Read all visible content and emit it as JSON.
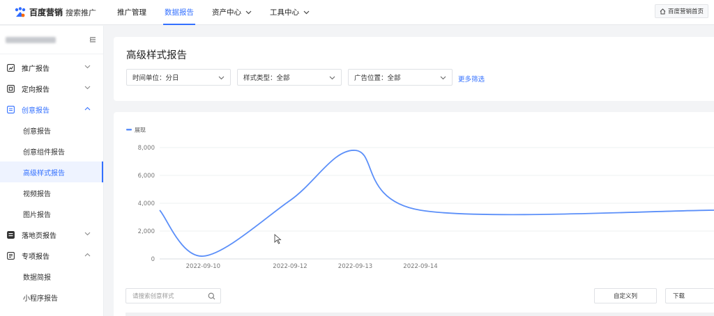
{
  "topnav": {
    "brand": "百度营销",
    "product": "搜索推广",
    "items": [
      {
        "label": "推广管理",
        "active": false,
        "dropdown": false
      },
      {
        "label": "数据报告",
        "active": true,
        "dropdown": false
      },
      {
        "label": "资产中心",
        "active": false,
        "dropdown": true
      },
      {
        "label": "工具中心",
        "active": false,
        "dropdown": true
      }
    ],
    "home_label": "百度营销首页"
  },
  "sidebar": {
    "menu": [
      {
        "label": "推广报告",
        "icon": "chart-box-icon",
        "expanded": false
      },
      {
        "label": "定向报告",
        "icon": "target-box-icon",
        "expanded": false
      },
      {
        "label": "创意报告",
        "icon": "idea-box-icon",
        "expanded": true,
        "children": [
          "创意报告",
          "创意组件报告",
          "高级样式报告",
          "视频报告",
          "图片报告"
        ]
      },
      {
        "label": "落地页报告",
        "icon": "page-box-icon",
        "expanded": false
      },
      {
        "label": "专项报告",
        "icon": "special-box-icon",
        "expanded": true,
        "children": [
          "数据简报",
          "小程序报告"
        ]
      }
    ],
    "active_child": "高级样式报告"
  },
  "filters": {
    "title": "高级样式报告",
    "time_unit": "时间单位：分日",
    "style_type": "样式类型：全部",
    "ad_position": "广告位置：全部",
    "more": "更多筛选"
  },
  "toolbar": {
    "search_placeholder": "请搜索创意样式",
    "customize_columns": "自定义列",
    "download": "下载"
  },
  "colors": {
    "accent": "#3370ff",
    "series": "#5b8ff9"
  },
  "chart_data": {
    "type": "line",
    "legend": [
      "展现"
    ],
    "legend_position": "top-left",
    "x_ticks": [
      "2022-09-10",
      "2022-09-12",
      "2022-09-13",
      "2022-09-14"
    ],
    "y_ticks": [
      "8,000",
      "6,000",
      "4,000",
      "2,000",
      "0"
    ],
    "ylim": [
      0,
      8000
    ],
    "grid": true,
    "series": [
      {
        "name": "展现",
        "points": [
          {
            "x": "2022-09-09",
            "y": 3500
          },
          {
            "x": "2022-09-10",
            "y": 200
          },
          {
            "x": "2022-09-12",
            "y": 4200
          },
          {
            "x": "2022-09-13",
            "y": 7800
          },
          {
            "x": "2022-09-14",
            "y": 3500
          }
        ]
      }
    ]
  }
}
